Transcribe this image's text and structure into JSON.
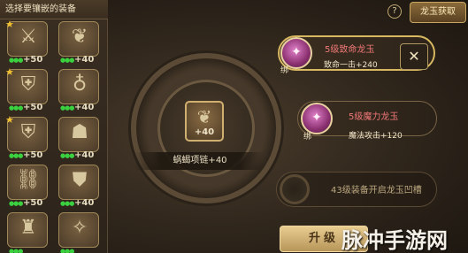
{
  "left_panel": {
    "title": "选择要镶嵌的装备",
    "items": [
      {
        "icon": "armor-icon",
        "glyph": "⚔",
        "starred": true,
        "bonus": "+50"
      },
      {
        "icon": "necklace-icon",
        "glyph": "❦",
        "starred": false,
        "bonus": "+40"
      },
      {
        "icon": "armor-icon",
        "glyph": "⛨",
        "starred": true,
        "bonus": "+50"
      },
      {
        "icon": "earring-icon",
        "glyph": "♁",
        "starred": false,
        "bonus": "+40"
      },
      {
        "icon": "armor-icon",
        "glyph": "⛨",
        "starred": true,
        "bonus": "+50"
      },
      {
        "icon": "helmet-icon",
        "glyph": "☗",
        "starred": false,
        "bonus": "+40"
      },
      {
        "icon": "bracer-icon",
        "glyph": "⛓",
        "starred": false,
        "bonus": "+50"
      },
      {
        "icon": "shield-icon",
        "glyph": "⛊",
        "starred": false,
        "bonus": "+40"
      },
      {
        "icon": "boots-icon",
        "glyph": "♜",
        "starred": false,
        "bonus": ""
      },
      {
        "icon": "ring-icon",
        "glyph": "✧",
        "starred": false,
        "bonus": ""
      }
    ]
  },
  "header": {
    "help_label": "?",
    "get_button": "龙玉获取"
  },
  "center": {
    "item_icon": "necklace-icon",
    "item_bonus": "+40",
    "item_name": "蜗蝎项链+40"
  },
  "gems": [
    {
      "bind_label": "绑",
      "name": "5级致命龙玉",
      "effect": "致命一击+240",
      "icon": "dragon-jade-icon"
    },
    {
      "bind_label": "绑",
      "name": "5级魔力龙玉",
      "effect": "魔法攻击+120",
      "icon": "dragon-jade-icon"
    }
  ],
  "locked_slot": {
    "text": "43级装备开启龙玉凹槽"
  },
  "remove_label": "✕",
  "upgrade_button": "升级",
  "watermark": "脉冲手游网"
}
